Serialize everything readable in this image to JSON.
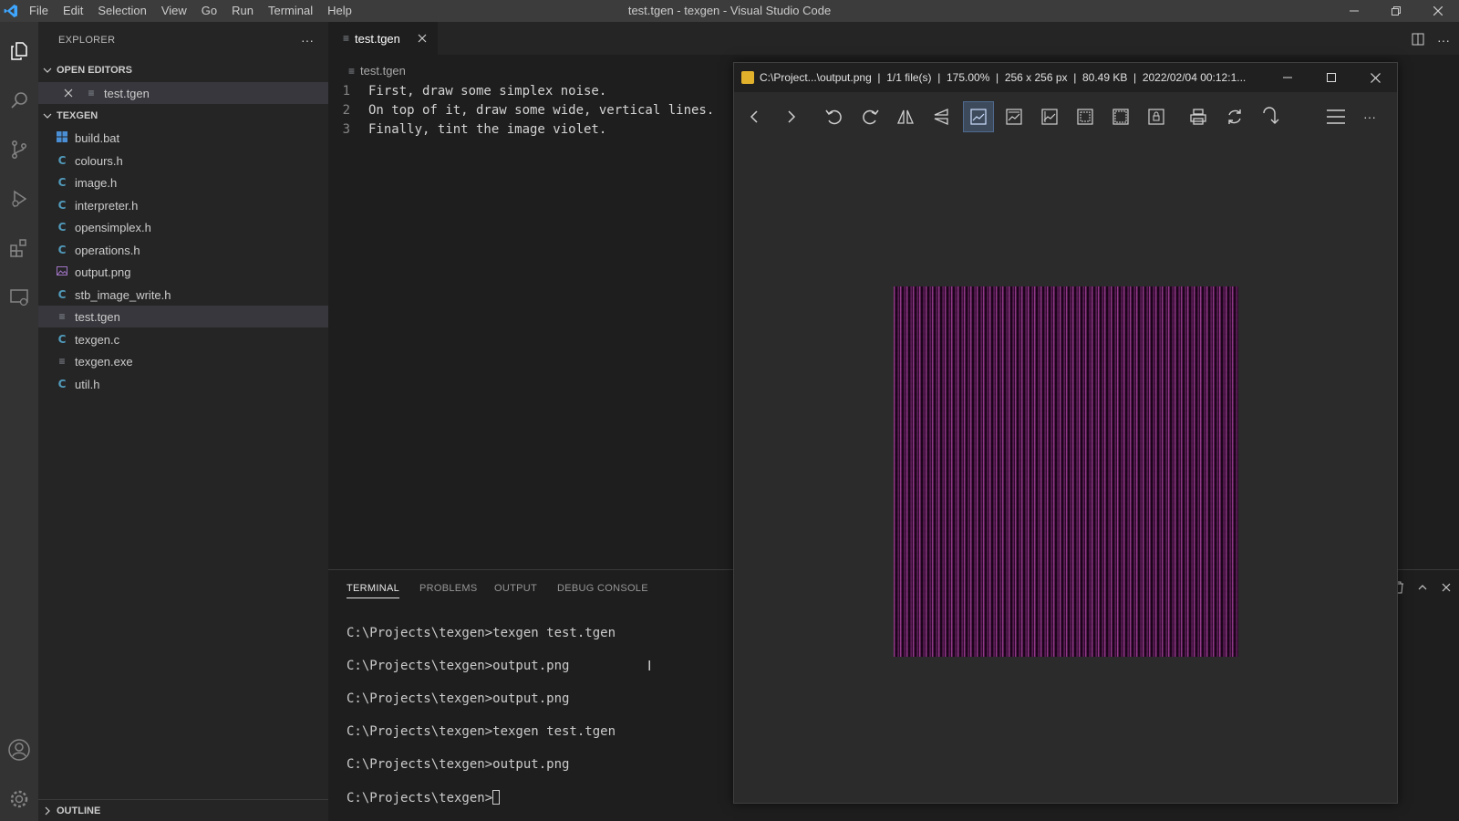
{
  "window_title": "test.tgen - texgen - Visual Studio Code",
  "menu": [
    "File",
    "Edit",
    "Selection",
    "View",
    "Go",
    "Run",
    "Terminal",
    "Help"
  ],
  "sidebar": {
    "header": "EXPLORER",
    "more": "···",
    "open_editors_label": "OPEN EDITORS",
    "open_editors": [
      {
        "name": "test.tgen",
        "icon": "lines-icon"
      }
    ],
    "folder_label": "TEXGEN",
    "files": [
      {
        "name": "build.bat",
        "icon": "windows-icon"
      },
      {
        "name": "colours.h",
        "icon": "c-icon"
      },
      {
        "name": "image.h",
        "icon": "c-icon"
      },
      {
        "name": "interpreter.h",
        "icon": "c-icon"
      },
      {
        "name": "opensimplex.h",
        "icon": "c-icon"
      },
      {
        "name": "operations.h",
        "icon": "c-icon"
      },
      {
        "name": "output.png",
        "icon": "image-icon"
      },
      {
        "name": "stb_image_write.h",
        "icon": "c-icon"
      },
      {
        "name": "test.tgen",
        "icon": "lines-icon"
      },
      {
        "name": "texgen.c",
        "icon": "c-icon"
      },
      {
        "name": "texgen.exe",
        "icon": "lines-icon"
      },
      {
        "name": "util.h",
        "icon": "c-icon"
      }
    ],
    "outline_label": "OUTLINE"
  },
  "editor": {
    "tab_label": "test.tgen",
    "breadcrumb": "test.tgen",
    "lines": [
      {
        "num": "1",
        "text": "First, draw some simplex noise."
      },
      {
        "num": "2",
        "text": "On top of it, draw some wide, vertical lines."
      },
      {
        "num": "3",
        "text": "Finally, tint the image violet."
      }
    ]
  },
  "panel": {
    "tabs": [
      "TERMINAL",
      "PROBLEMS",
      "OUTPUT",
      "DEBUG CONSOLE"
    ],
    "active_tab": "TERMINAL",
    "terminal_lines": [
      "C:\\Projects\\texgen>texgen test.tgen",
      "C:\\Projects\\texgen>output.png",
      "C:\\Projects\\texgen>output.png",
      "C:\\Projects\\texgen>texgen test.tgen",
      "C:\\Projects\\texgen>output.png"
    ],
    "prompt": "C:\\Projects\\texgen>"
  },
  "viewer": {
    "title": "C:\\Project...\\output.png  |  1/1 file(s)  |  175.00%  |  256 x 256 px  |  80.49 KB  |  2022/02/04 00:12:1...",
    "more": "···",
    "image_tint": "#c84fbf"
  },
  "colors": {
    "accent_blue": "#0078d4",
    "titlebar": "#3c3c3c",
    "sidebar": "#252526",
    "editor_bg": "#1e1e1e"
  }
}
